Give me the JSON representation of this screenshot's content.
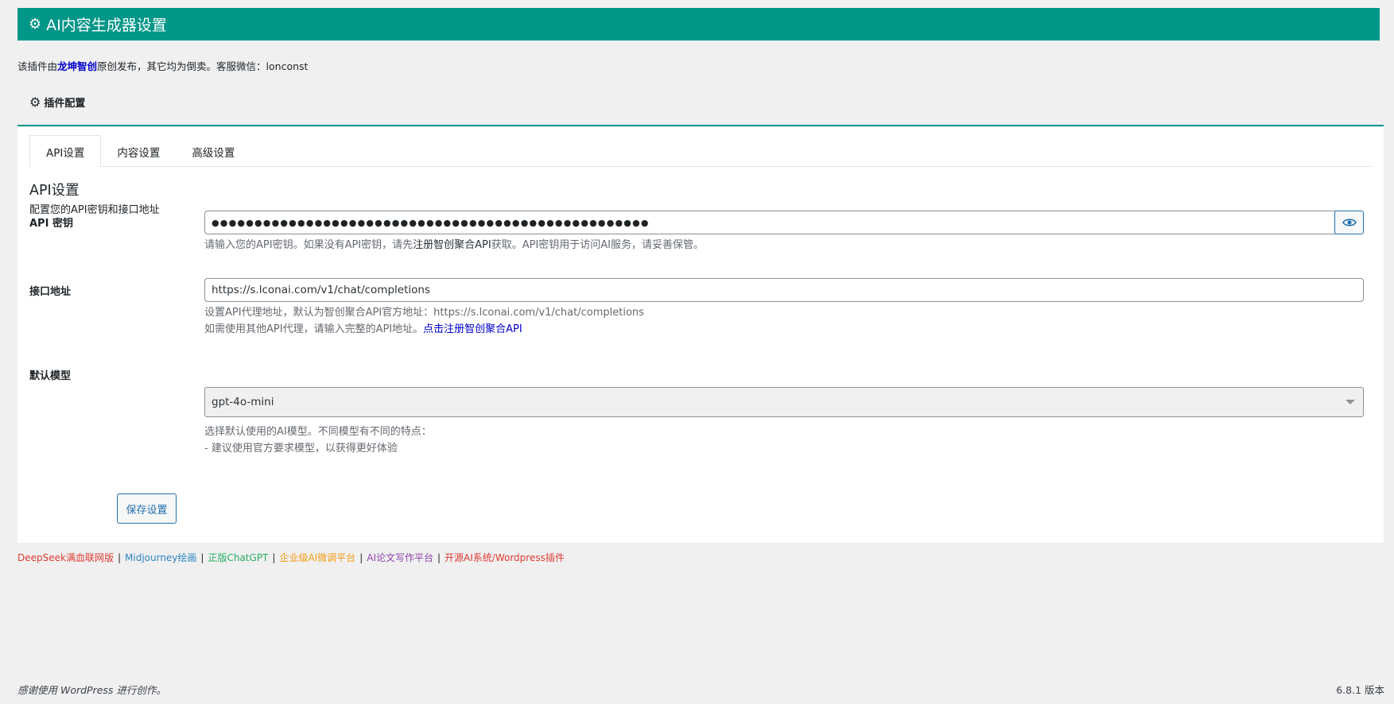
{
  "header": {
    "title": "AI内容生成器设置",
    "icon": "gear-icon"
  },
  "notice": {
    "prefix": "该插件由",
    "brand": "龙坤智创",
    "suffix": "原创发布，其它均为倒卖。客服微信：lonconst"
  },
  "config": {
    "title": "插件配置",
    "icon": "gear-icon"
  },
  "tabs": [
    {
      "label": "API设置",
      "active": true
    },
    {
      "label": "内容设置",
      "active": false
    },
    {
      "label": "高级设置",
      "active": false
    }
  ],
  "section": {
    "title": "API设置",
    "description": "配置您的API密钥和接口地址"
  },
  "api_key": {
    "label": "API 密钥",
    "value": "●●●●●●●●●●●●●●●●●●●●●●●●●●●●●●●●●●●●●●●●●●●●●●●●●●●",
    "toggle_icon": "eye-icon",
    "help_prefix": "请输入您的API密钥。如果没有API密钥，请先",
    "help_strong": "注册智创聚合API",
    "help_suffix": "获取。API密钥用于访问AI服务，请妥善保管。"
  },
  "endpoint": {
    "label": "接口地址",
    "value": "https://s.lconai.com/v1/chat/completions",
    "help_line1": "设置API代理地址，默认为智创聚合API官方地址：https://s.lconai.com/v1/chat/completions",
    "help_line2_prefix": "如需使用其他API代理，请输入完整的API地址。",
    "help_line2_link": "点击注册智创聚合API"
  },
  "model": {
    "label": "默认模型",
    "selected": "gpt-4o-mini",
    "help_line1": "选择默认使用的AI模型。不同模型有不同的特点：",
    "help_line2": "- 建议使用官方要求模型，以获得更好体验"
  },
  "save_label": "保存设置",
  "links": [
    {
      "label": "DeepSeek满血联网版",
      "color": "#e03c31"
    },
    {
      "label": "Midjourney绘画",
      "color": "#2e86c1"
    },
    {
      "label": "正版ChatGPT",
      "color": "#27ae60"
    },
    {
      "label": "企业级AI微调平台",
      "color": "#f39c12"
    },
    {
      "label": "AI论文写作平台",
      "color": "#8e44ad"
    },
    {
      "label": "开源AI系统/Wordpress插件",
      "color": "#e03c31"
    }
  ],
  "footer": {
    "left": "感谢使用 WordPress 进行创作。",
    "right": "6.8.1 版本"
  }
}
